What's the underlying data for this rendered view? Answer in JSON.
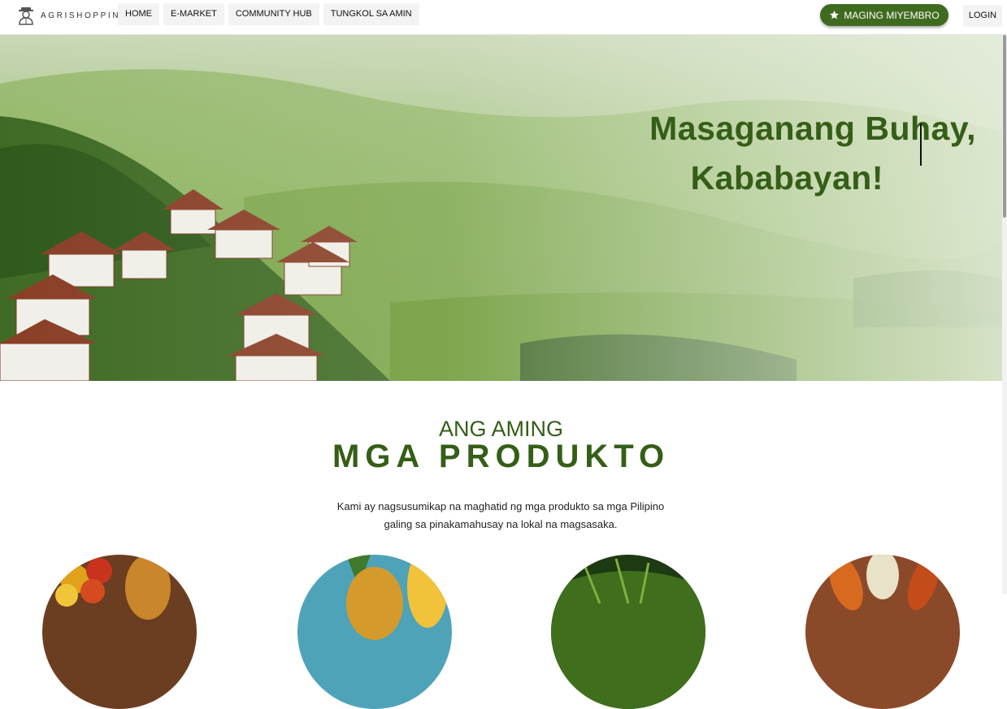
{
  "brand": {
    "name": "AGRISHOPPING",
    "logo_icon": "farmer-icon"
  },
  "nav": {
    "links": [
      "HOME",
      "E-MARKET",
      "COMMUNITY HUB",
      "TUNGKOL SA AMIN"
    ],
    "member_label": "MAGING MIYEMBRO",
    "member_icon": "star-icon",
    "login_label": "LOGIN"
  },
  "hero": {
    "title_line1": "Masaganang Buhay,",
    "title_line2": "Kababayan!"
  },
  "products": {
    "kicker": "ANG AMING",
    "title": "MGA PRODUKTO",
    "intro_line1": "Kami ay nagsusumikap na maghatid ng mga produkto sa mga Pilipino",
    "intro_line2": "galing sa pinakamahusay na lokal na magsasaka."
  },
  "colors": {
    "accent": "#3f6b1f",
    "title_green": "#355e17"
  }
}
